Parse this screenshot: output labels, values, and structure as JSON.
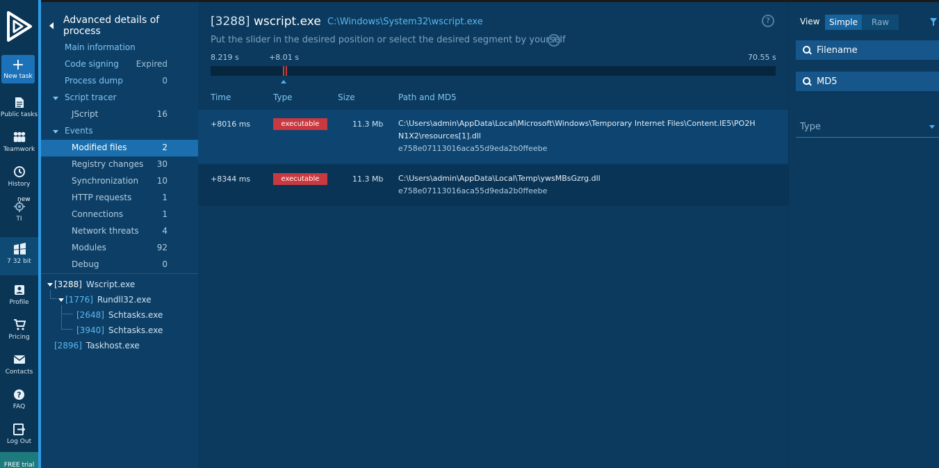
{
  "rail": {
    "new_task": "New task",
    "public_tasks": "Public tasks",
    "teamwork": "Teamwork",
    "history": "History",
    "ti": "TI",
    "ti_badge": "new",
    "os": "7 32 bit",
    "profile": "Profile",
    "pricing": "Pricing",
    "contacts": "Contacts",
    "faq": "FAQ",
    "logout": "Log Out",
    "free_trial": "FREE trial"
  },
  "details": {
    "title": "Advanced details of process",
    "main_information": "Main information",
    "code_signing": {
      "label": "Code signing",
      "value": "Expired"
    },
    "process_dump": {
      "label": "Process dump",
      "value": "0"
    },
    "script_tracer": "Script tracer",
    "jscript": {
      "label": "JScript",
      "value": "16"
    },
    "events": "Events",
    "modified_files": {
      "label": "Modified files",
      "value": "2"
    },
    "registry_changes": {
      "label": "Registry changes",
      "value": "30"
    },
    "synchronization": {
      "label": "Synchronization",
      "value": "10"
    },
    "http_requests": {
      "label": "HTTP requests",
      "value": "1"
    },
    "connections": {
      "label": "Connections",
      "value": "1"
    },
    "network_threats": {
      "label": "Network threats",
      "value": "4"
    },
    "modules": {
      "label": "Modules",
      "value": "92"
    },
    "debug": {
      "label": "Debug",
      "value": "0"
    }
  },
  "tree": {
    "p1": {
      "pid": "[3288]",
      "name": "Wscript.exe"
    },
    "p2": {
      "pid": "[1776]",
      "name": "Rundll32.exe"
    },
    "p3": {
      "pid": "[2648]",
      "name": "Schtasks.exe"
    },
    "p4": {
      "pid": "[3940]",
      "name": "Schtasks.exe"
    },
    "p5": {
      "pid": "[2896]",
      "name": "Taskhost.exe"
    }
  },
  "main": {
    "pid": "[3288]",
    "process": "wscript.exe",
    "path": "C:\\Windows\\System32\\wscript.exe",
    "hint": "Put the slider in the desired position or select the desired segment by yourself",
    "help_icon": "?",
    "slider": {
      "start": "8.219 s",
      "marker": "+8.01 s",
      "end": "70.55 s"
    },
    "columns": {
      "time": "Time",
      "type": "Type",
      "size": "Size",
      "path": "Path and MD5"
    },
    "rows": [
      {
        "time": "+8016 ms",
        "type": "executable",
        "size": "11.3 Mb",
        "path": "C:\\Users\\admin\\AppData\\Local\\Microsoft\\Windows\\Temporary Internet Files\\Content.IE5\\PO2H N1X2\\resources[1].dll",
        "md5": "e758e07113016aca55d9eda2b0ffeebe"
      },
      {
        "time": "+8344 ms",
        "type": "executable",
        "size": "11.3 Mb",
        "path": "C:\\Users\\admin\\AppData\\Local\\Temp\\ywsMBsGzrg.dll",
        "md5": "e758e07113016aca55d9eda2b0ffeebe"
      }
    ]
  },
  "filters": {
    "view_label": "View",
    "simple": "Simple",
    "raw": "Raw",
    "filename_placeholder": "Filename",
    "md5_placeholder": "MD5",
    "type_label": "Type"
  }
}
